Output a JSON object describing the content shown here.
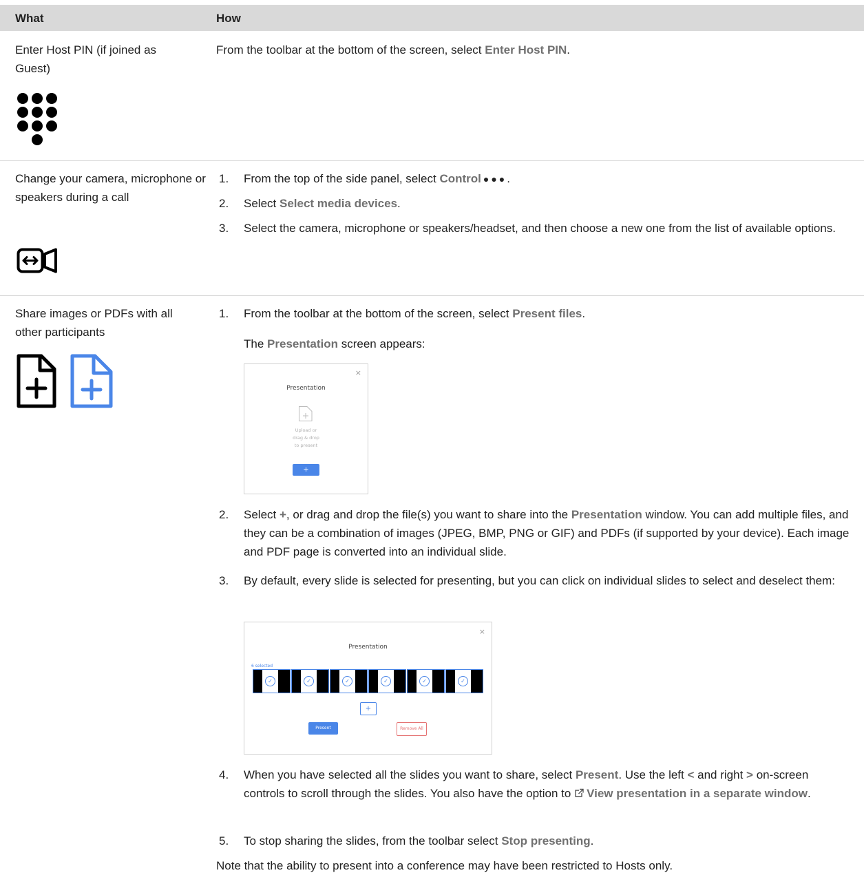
{
  "header": {
    "col_what": "What",
    "col_how": "How"
  },
  "rows": [
    {
      "what": "Enter Host PIN (if joined as Guest)",
      "how_pre": "From the toolbar at the bottom of the screen, select ",
      "how_bold": "Enter Host PIN",
      "how_post": "."
    },
    {
      "what": "Change your camera, microphone or speakers during a call",
      "steps": [
        {
          "num": "1.",
          "pre": "From the top of the side panel, select ",
          "bold": "Control",
          "post": "."
        },
        {
          "num": "2.",
          "pre": "Select ",
          "bold": "Select media devices",
          "post": "."
        },
        {
          "num": "3.",
          "text": "Select the camera, microphone or speakers/headset, and then choose a new one from the list of available options."
        }
      ]
    },
    {
      "what": "Share images or PDFs with all other participants",
      "step1": {
        "num": "1.",
        "pre": "From the toolbar at the bottom of the screen, select ",
        "bold": "Present files",
        "post": "."
      },
      "appears": {
        "pre": "The ",
        "bold": "Presentation",
        "post": " screen appears:"
      },
      "shot1": {
        "title": "Presentation",
        "close": "×",
        "upload_text": [
          "Upload or",
          "drag & drop",
          "to present"
        ],
        "add": "+"
      },
      "step2": {
        "num": "2.",
        "pre": "Select ",
        "bold1": "+",
        "mid": ", or drag and drop the file(s) you want to share into the ",
        "bold2": "Presentation",
        "post": " window. You can add multiple files, and they can be a combination of images (JPEG, BMP, PNG or GIF) and PDFs (if supported by your device). Each image and PDF page is converted into an individual slide."
      },
      "step3": {
        "num": "3.",
        "text": "By default, every slide is selected for presenting, but you can click on individual slides to select and deselect them:"
      },
      "shot2": {
        "title": "Presentation",
        "close": "×",
        "selected": "6 selected",
        "add": "+",
        "present": "Present",
        "remove": "Remove All"
      },
      "step4": {
        "num": "4.",
        "pre": "When you have selected all the slides you want to share, select ",
        "bold1": "Present",
        "mid1": ". Use the left ",
        "bold2": "<",
        "mid2": " and right ",
        "bold3": ">",
        "mid3": " on-screen controls to scroll through the slides. You also have the option to ",
        "bold4": "View presentation in a separate window",
        "post": "."
      },
      "step5": {
        "num": "5.",
        "pre": "To stop sharing the slides, from the toolbar select ",
        "bold": "Stop presenting",
        "post": "."
      },
      "note": "Note that the ability to present into a conference may have been restricted to Hosts only."
    }
  ],
  "colors": {
    "header_bg": "#d9d9d9",
    "keyword": "#707070",
    "accent": "#4a86e8",
    "danger": "#e57373"
  }
}
